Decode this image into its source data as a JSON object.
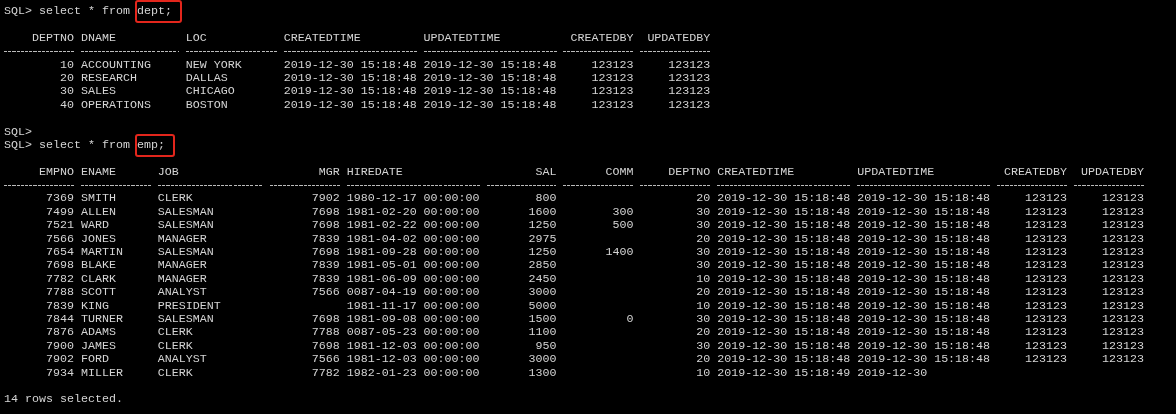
{
  "terminal": {
    "lines": [
      {
        "kind": "command",
        "prompt": "SQL>",
        "text": "select * from",
        "highlight": "dept;"
      },
      {
        "kind": "blank"
      },
      {
        "kind": "table",
        "columns": [
          "DEPTNO",
          "DNAME",
          "LOC",
          "CREATEDTIME",
          "UPDATEDTIME",
          "CREATEDBY",
          "UPDATEDBY"
        ],
        "rows": [
          [
            "10",
            "ACCOUNTING",
            "NEW YORK",
            "2019-12-30 15:18:48",
            "2019-12-30 15:18:48",
            "123123",
            "123123"
          ],
          [
            "20",
            "RESEARCH",
            "DALLAS",
            "2019-12-30 15:18:48",
            "2019-12-30 15:18:48",
            "123123",
            "123123"
          ],
          [
            "30",
            "SALES",
            "CHICAGO",
            "2019-12-30 15:18:48",
            "2019-12-30 15:18:48",
            "123123",
            "123123"
          ],
          [
            "40",
            "OPERATIONS",
            "BOSTON",
            "2019-12-30 15:18:48",
            "2019-12-30 15:18:48",
            "123123",
            "123123"
          ]
        ]
      },
      {
        "kind": "blank"
      },
      {
        "kind": "prompt",
        "prompt": "SQL>"
      },
      {
        "kind": "command",
        "prompt": "SQL>",
        "text": "select * from",
        "highlight": "emp;"
      },
      {
        "kind": "blank"
      },
      {
        "kind": "table",
        "columns": [
          "EMPNO",
          "ENAME",
          "JOB",
          "MGR",
          "HIREDATE",
          "SAL",
          "COMM",
          "DEPTNO",
          "CREATEDTIME",
          "UPDATEDTIME",
          "CREATEDBY",
          "UPDATEDBY"
        ],
        "rows": [
          [
            "7369",
            "SMITH",
            "CLERK",
            "7902",
            "1980-12-17 00:00:00",
            "800",
            "",
            "20",
            "2019-12-30 15:18:48",
            "2019-12-30 15:18:48",
            "123123",
            "123123"
          ],
          [
            "7499",
            "ALLEN",
            "SALESMAN",
            "7698",
            "1981-02-20 00:00:00",
            "1600",
            "300",
            "30",
            "2019-12-30 15:18:48",
            "2019-12-30 15:18:48",
            "123123",
            "123123"
          ],
          [
            "7521",
            "WARD",
            "SALESMAN",
            "7698",
            "1981-02-22 00:00:00",
            "1250",
            "500",
            "30",
            "2019-12-30 15:18:48",
            "2019-12-30 15:18:48",
            "123123",
            "123123"
          ],
          [
            "7566",
            "JONES",
            "MANAGER",
            "7839",
            "1981-04-02 00:00:00",
            "2975",
            "",
            "20",
            "2019-12-30 15:18:48",
            "2019-12-30 15:18:48",
            "123123",
            "123123"
          ],
          [
            "7654",
            "MARTIN",
            "SALESMAN",
            "7698",
            "1981-09-28 00:00:00",
            "1250",
            "1400",
            "30",
            "2019-12-30 15:18:48",
            "2019-12-30 15:18:48",
            "123123",
            "123123"
          ],
          [
            "7698",
            "BLAKE",
            "MANAGER",
            "7839",
            "1981-05-01 00:00:00",
            "2850",
            "",
            "30",
            "2019-12-30 15:18:48",
            "2019-12-30 15:18:48",
            "123123",
            "123123"
          ],
          [
            "7782",
            "CLARK",
            "MANAGER",
            "7839",
            "1981-06-09 00:00:00",
            "2450",
            "",
            "10",
            "2019-12-30 15:18:48",
            "2019-12-30 15:18:48",
            "123123",
            "123123"
          ],
          [
            "7788",
            "SCOTT",
            "ANALYST",
            "7566",
            "0087-04-19 00:00:00",
            "3000",
            "",
            "20",
            "2019-12-30 15:18:48",
            "2019-12-30 15:18:48",
            "123123",
            "123123"
          ],
          [
            "7839",
            "KING",
            "PRESIDENT",
            "",
            "1981-11-17 00:00:00",
            "5000",
            "",
            "10",
            "2019-12-30 15:18:48",
            "2019-12-30 15:18:48",
            "123123",
            "123123"
          ],
          [
            "7844",
            "TURNER",
            "SALESMAN",
            "7698",
            "1981-09-08 00:00:00",
            "1500",
            "0",
            "30",
            "2019-12-30 15:18:48",
            "2019-12-30 15:18:48",
            "123123",
            "123123"
          ],
          [
            "7876",
            "ADAMS",
            "CLERK",
            "7788",
            "0087-05-23 00:00:00",
            "1100",
            "",
            "20",
            "2019-12-30 15:18:48",
            "2019-12-30 15:18:48",
            "123123",
            "123123"
          ],
          [
            "7900",
            "JAMES",
            "CLERK",
            "7698",
            "1981-12-03 00:00:00",
            "950",
            "",
            "30",
            "2019-12-30 15:18:48",
            "2019-12-30 15:18:48",
            "123123",
            "123123"
          ],
          [
            "7902",
            "FORD",
            "ANALYST",
            "7566",
            "1981-12-03 00:00:00",
            "3000",
            "",
            "20",
            "2019-12-30 15:18:48",
            "2019-12-30 15:18:48",
            "123123",
            "123123"
          ],
          [
            "7934",
            "MILLER",
            "CLERK",
            "7782",
            "1982-01-23 00:00:00",
            "1300",
            "",
            "10",
            "2019-12-30 15:18:49",
            "2019-12-30"
          ]
        ]
      },
      {
        "kind": "blank"
      },
      {
        "kind": "message",
        "text": "14 rows selected."
      }
    ]
  }
}
